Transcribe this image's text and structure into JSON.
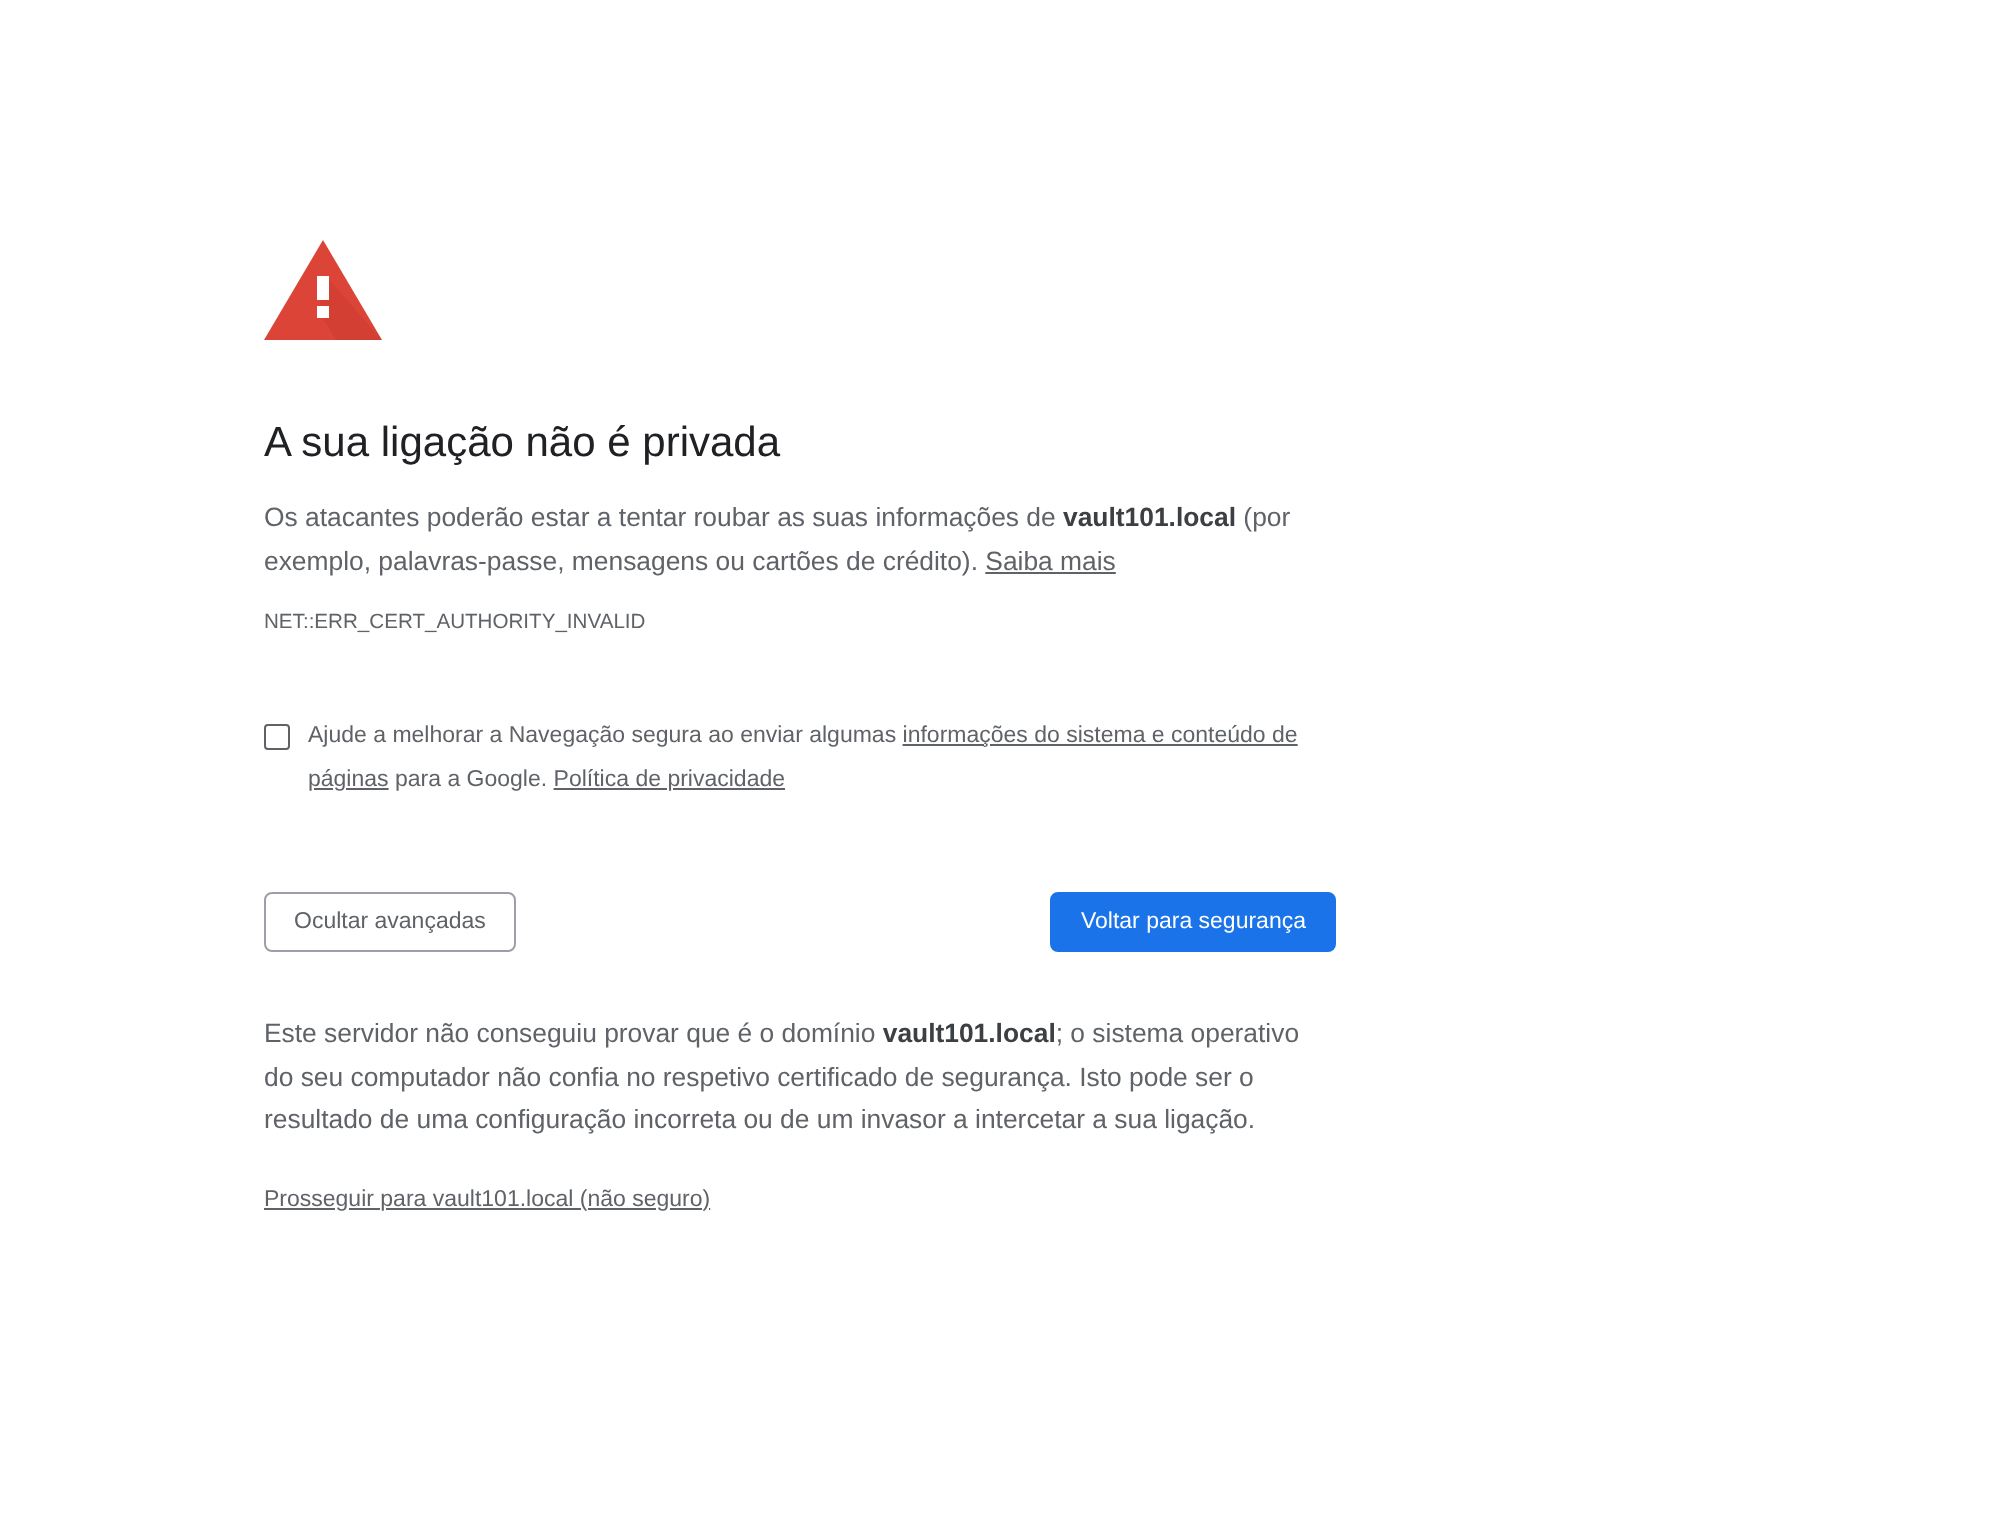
{
  "warning": {
    "title": "A sua ligação não é privada",
    "description": {
      "text": "Os atacantes poderão estar a tentar roubar as suas informações de **vault101.local** (por exemplo, palavras-passe, mensagens ou cartões de crédito).",
      "link": "Saiba mais"
    },
    "error_code": "NET::ERR_CERT_AUTHORITY_INVALID"
  },
  "safe_browsing_opt_in": {
    "checked": false,
    "segments": [
      {
        "kind": "text",
        "text": "Ajude a melhorar a Navegação segura ao enviar algumas"
      },
      {
        "kind": "link",
        "text": "informações do sistema e conteúdo de"
      },
      {
        "kind": "link",
        "text": "páginas"
      },
      {
        "kind": "text",
        "text": "para a Google."
      },
      {
        "kind": "link",
        "text": "Política de privacidade"
      }
    ]
  },
  "buttons": [
    {
      "kind": "secondary",
      "label": "Ocultar avançadas"
    },
    {
      "kind": "primary",
      "label": "Voltar para segurança"
    }
  ],
  "details": {
    "text": "Este servidor não conseguiu provar que é o domínio **vault101.local**; o sistema operativo do seu computador não confia no respetivo certificado de segurança. Isto pode ser o resultado de uma configuração incorreta ou de um invasor a intercetar a sua ligação.",
    "proceed_link": "Prosseguir para vault101.local (não seguro)"
  }
}
